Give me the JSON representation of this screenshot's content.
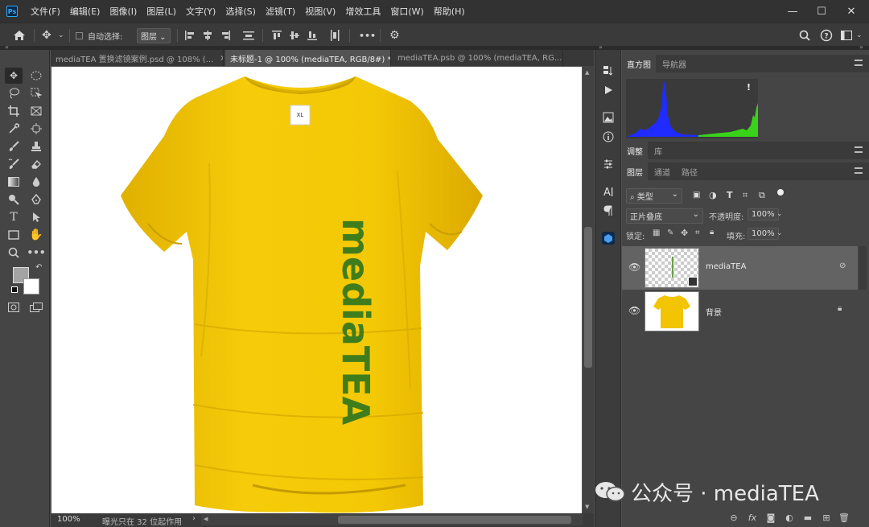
{
  "app": {
    "logo": "Ps",
    "menu": [
      "文件(F)",
      "编辑(E)",
      "图像(I)",
      "图层(L)",
      "文字(Y)",
      "选择(S)",
      "滤镜(T)",
      "视图(V)",
      "增效工具",
      "窗口(W)",
      "帮助(H)"
    ],
    "window_buttons": [
      "—",
      "☐",
      "✕"
    ]
  },
  "options": {
    "auto_select_label": "自动选择:",
    "auto_select_target": "图层",
    "more": "•••"
  },
  "tabs": [
    {
      "label": "mediaTEA 置换滤镜案例.psd @ 108% (...",
      "close": "×"
    },
    {
      "label": "未标题-1 @ 100% (mediaTEA, RGB/8#) *",
      "close": "×"
    },
    {
      "label": "mediaTEA.psb @ 100% (mediaTEA, RG...",
      "close": "×"
    }
  ],
  "canvas": {
    "shirt_label_size": "XL",
    "vertical_text": "mediaTEA",
    "shirt_color": "#f2c500",
    "text_color": "#3f7d1c"
  },
  "status": {
    "zoom": "100%",
    "message": "曝光只在 32 位起作用"
  },
  "panels": {
    "histogram_tabs": [
      "直方图",
      "导航器"
    ],
    "adjust_tabs": [
      "调整",
      "库"
    ],
    "layers_tabs": [
      "图层",
      "通道",
      "路径"
    ],
    "filter_kind": "类型",
    "blend_mode": "正片叠底",
    "opacity_label": "不透明度:",
    "opacity_value": "100%",
    "lock_label": "锁定:",
    "fill_label": "填充:",
    "fill_value": "100%",
    "warning": "!",
    "layers": [
      {
        "name": "mediaTEA",
        "selected": true
      },
      {
        "name": "背景",
        "selected": false
      }
    ]
  },
  "watermark": "公众号 · mediaTEA",
  "colors": {
    "histogram_blue": "#1f2bff",
    "histogram_green": "#39d41a"
  }
}
